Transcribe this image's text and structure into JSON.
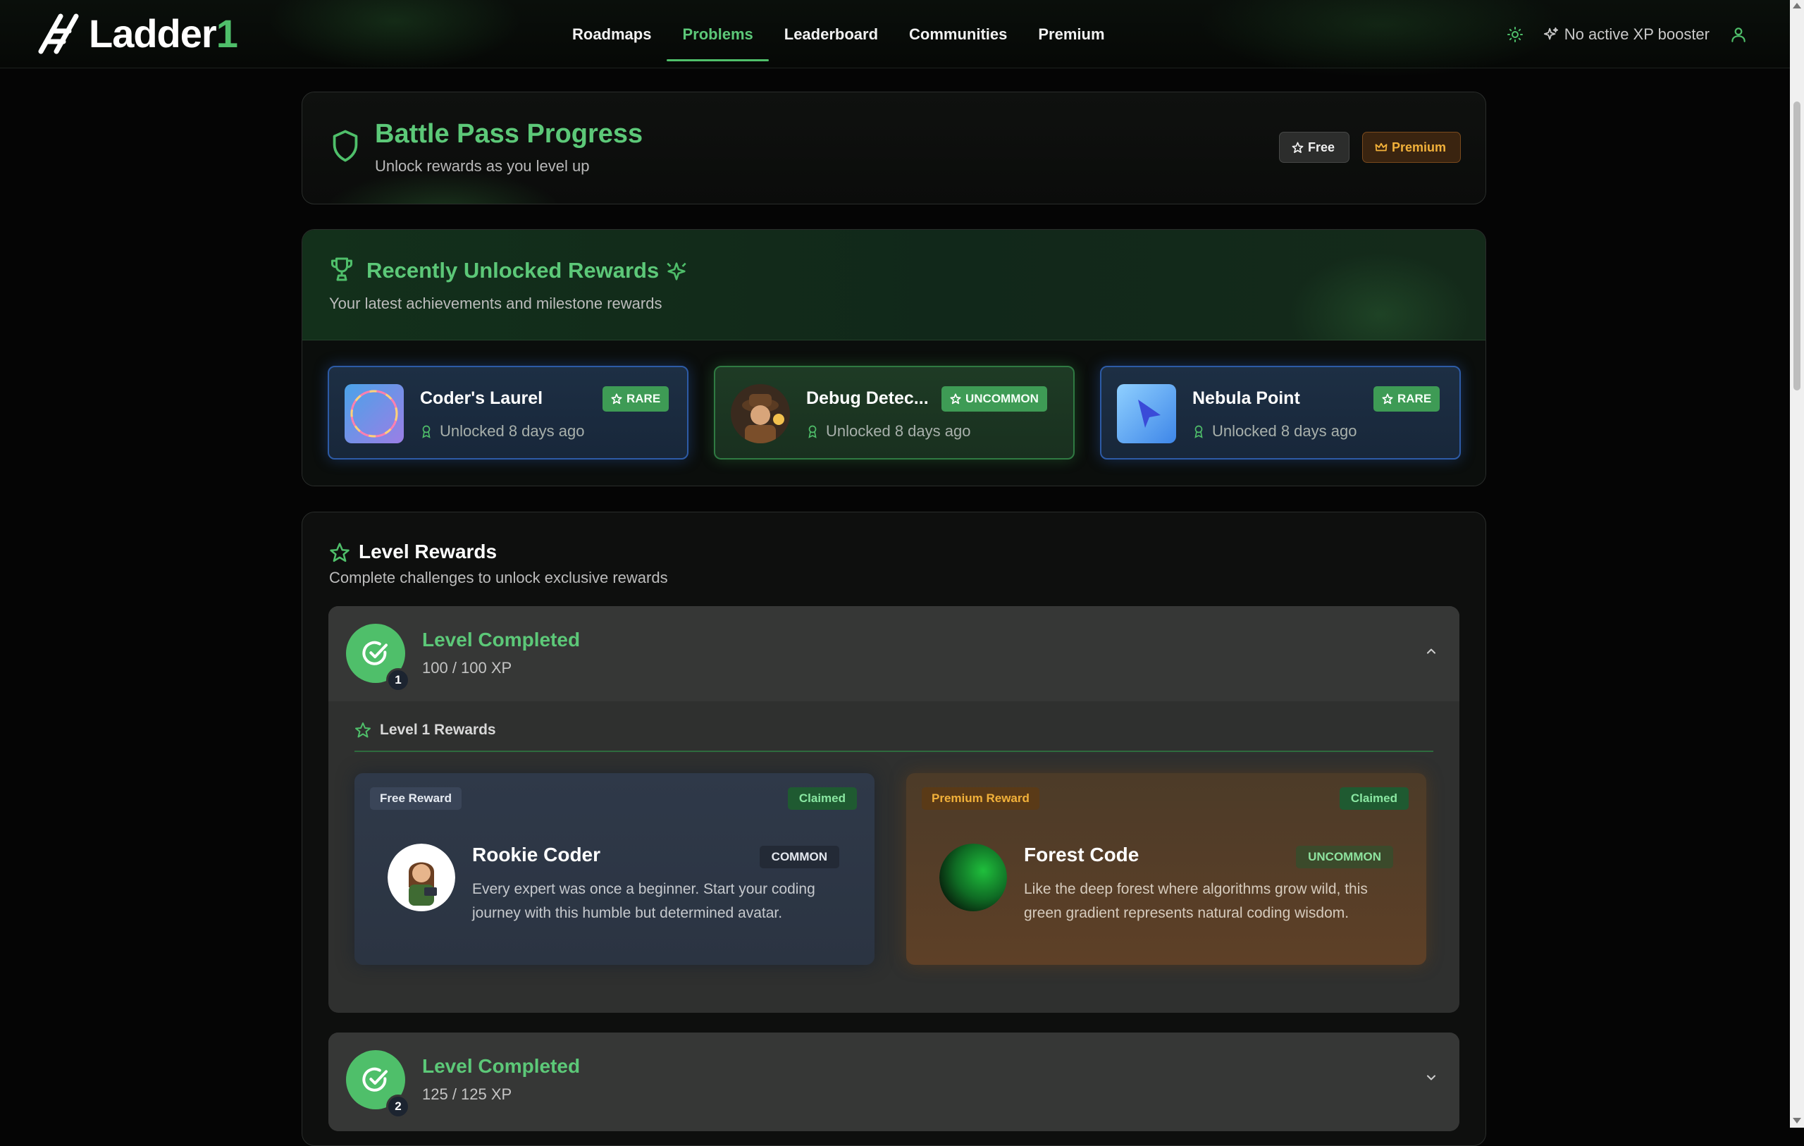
{
  "header": {
    "logo_text": "Ladder",
    "logo_accent": "1",
    "nav": [
      "Roadmaps",
      "Problems",
      "Leaderboard",
      "Communities",
      "Premium"
    ],
    "active_nav": "Problems",
    "booster_text": "No active XP booster"
  },
  "battle_pass": {
    "title": "Battle Pass Progress",
    "subtitle": "Unlock rewards as you level up",
    "free_label": "Free",
    "premium_label": "Premium"
  },
  "recent": {
    "title": "Recently Unlocked Rewards",
    "subtitle": "Your latest achievements and milestone rewards",
    "items": [
      {
        "name": "Coder's Laurel",
        "rarity": "RARE",
        "unlocked": "Unlocked 8 days ago"
      },
      {
        "name": "Debug Detec...",
        "rarity": "UNCOMMON",
        "unlocked": "Unlocked 8 days ago"
      },
      {
        "name": "Nebula Point",
        "rarity": "RARE",
        "unlocked": "Unlocked 8 days ago"
      }
    ]
  },
  "levels": {
    "title": "Level Rewards",
    "subtitle": "Complete challenges to unlock exclusive rewards",
    "items": [
      {
        "number": "1",
        "status": "Level Completed",
        "xp": "100 / 100 XP",
        "rewards_title": "Level 1 Rewards",
        "free": {
          "tag": "Free Reward",
          "state": "Claimed",
          "name": "Rookie Coder",
          "rarity": "COMMON",
          "description": "Every expert was once a beginner. Start your coding journey with this humble but determined avatar."
        },
        "premium": {
          "tag": "Premium Reward",
          "state": "Claimed",
          "name": "Forest Code",
          "rarity": "UNCOMMON",
          "description": "Like the deep forest where algorithms grow wild, this green gradient represents natural coding wisdom."
        }
      },
      {
        "number": "2",
        "status": "Level Completed",
        "xp": "125 / 125 XP"
      }
    ]
  },
  "colors": {
    "accent_green": "#4fbf6a",
    "premium_gold": "#f2b13a",
    "rare_blue": "#2d5ba6"
  },
  "icons": [
    "ladder-logo-icon",
    "sun-icon",
    "sparkle-icon",
    "user-icon",
    "shield-icon",
    "star-icon",
    "crown-icon",
    "trophy-icon",
    "award-icon",
    "check-circle-icon",
    "chevron-up-icon",
    "chevron-down-icon"
  ]
}
